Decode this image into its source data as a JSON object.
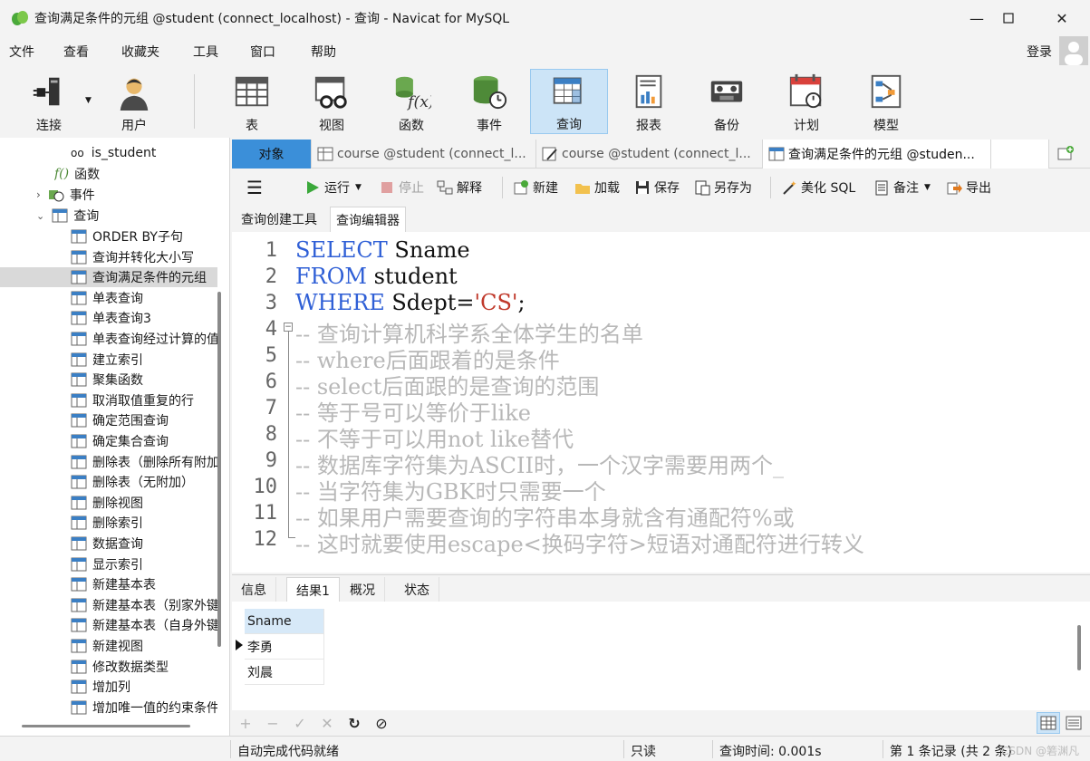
{
  "window": {
    "title": "查询满足条件的元组 @student (connect_localhost) - 查询 - Navicat for MySQL",
    "controls": [
      "minimize",
      "maximize",
      "close"
    ]
  },
  "menu": [
    "文件",
    "查看",
    "收藏夹",
    "工具",
    "窗口",
    "帮助"
  ],
  "login_label": "登录",
  "toolbar": [
    {
      "label": "连接",
      "icon": "connection-icon"
    },
    {
      "label": "用户",
      "icon": "user-icon"
    },
    {
      "label": "表",
      "icon": "table-icon"
    },
    {
      "label": "视图",
      "icon": "view-icon"
    },
    {
      "label": "函数",
      "icon": "function-icon"
    },
    {
      "label": "事件",
      "icon": "event-icon"
    },
    {
      "label": "查询",
      "icon": "query-icon",
      "active": true
    },
    {
      "label": "报表",
      "icon": "report-icon"
    },
    {
      "label": "备份",
      "icon": "backup-icon"
    },
    {
      "label": "计划",
      "icon": "schedule-icon"
    },
    {
      "label": "模型",
      "icon": "model-icon"
    }
  ],
  "tree": {
    "top_items": [
      "is_student",
      "函数",
      "事件",
      "查询"
    ],
    "queries": [
      "ORDER BY子句",
      "查询并转化大小写",
      "查询满足条件的元组",
      "单表查询",
      "单表查询3",
      "单表查询经过计算的值",
      "建立索引",
      "聚集函数",
      "取消取值重复的行",
      "确定范围查询",
      "确定集合查询",
      "删除表（删除所有附加",
      "删除表（无附加）",
      "删除视图",
      "删除索引",
      "数据查询",
      "显示索引",
      "新建基本表",
      "新建基本表（别家外键",
      "新建基本表（自身外键",
      "新建视图",
      "修改数据类型",
      "增加列",
      "增加唯一值的约束条件"
    ],
    "selected": "查询满足条件的元组"
  },
  "tabs": {
    "objects": "对象",
    "items": [
      "course @student (connect_l...",
      "course @student (connect_l...",
      "查询满足条件的元组 @studen..."
    ]
  },
  "editor_toolbar": {
    "run": "运行",
    "stop": "停止",
    "explain": "解释",
    "new": "新建",
    "load": "加载",
    "save": "保存",
    "save_as": "另存为",
    "beautify": "美化 SQL",
    "comment": "备注",
    "export": "导出"
  },
  "subtabs": [
    "查询创建工具",
    "查询编辑器"
  ],
  "code_lines": [
    {
      "n": "1",
      "kw": "SELECT",
      "rest": " Sname"
    },
    {
      "n": "2",
      "kw": "FROM",
      "rest": " student"
    },
    {
      "n": "3",
      "kw": "WHERE",
      "rest": " Sdept=",
      "str": "'CS'",
      "tail": ";"
    },
    {
      "n": "4",
      "comment": "-- 查询计算机科学系全体学生的名单"
    },
    {
      "n": "5",
      "comment": "-- where后面跟着的是条件"
    },
    {
      "n": "6",
      "comment": "-- select后面跟的是查询的范围"
    },
    {
      "n": "7",
      "comment": "-- 等于号可以等价于like"
    },
    {
      "n": "8",
      "comment": "-- 不等于可以用not like替代"
    },
    {
      "n": "9",
      "comment": "-- 数据库字符集为ASCII时，一个汉字需要用两个_"
    },
    {
      "n": "10",
      "comment": "-- 当字符集为GBK时只需要一个"
    },
    {
      "n": "11",
      "comment": "-- 如果用户需要查询的字符串本身就含有通配符%或"
    },
    {
      "n": "12",
      "comment": "-- 这时就要使用escape<换码字符>短语对通配符进行转义"
    }
  ],
  "result_tabs": [
    "信息",
    "结果1",
    "概况",
    "状态"
  ],
  "result": {
    "column": "Sname",
    "rows": [
      "李勇",
      "刘晨"
    ]
  },
  "grid_nav": [
    "+",
    "−",
    "✓",
    "✕",
    "↻",
    "⊘"
  ],
  "status": {
    "autocomplete": "自动完成代码就绪",
    "readonly": "只读",
    "query_time": "查询时间: 0.001s",
    "record": "第 1 条记录 (共 2 条)",
    "watermark": "CSDN @箬渊凡"
  }
}
